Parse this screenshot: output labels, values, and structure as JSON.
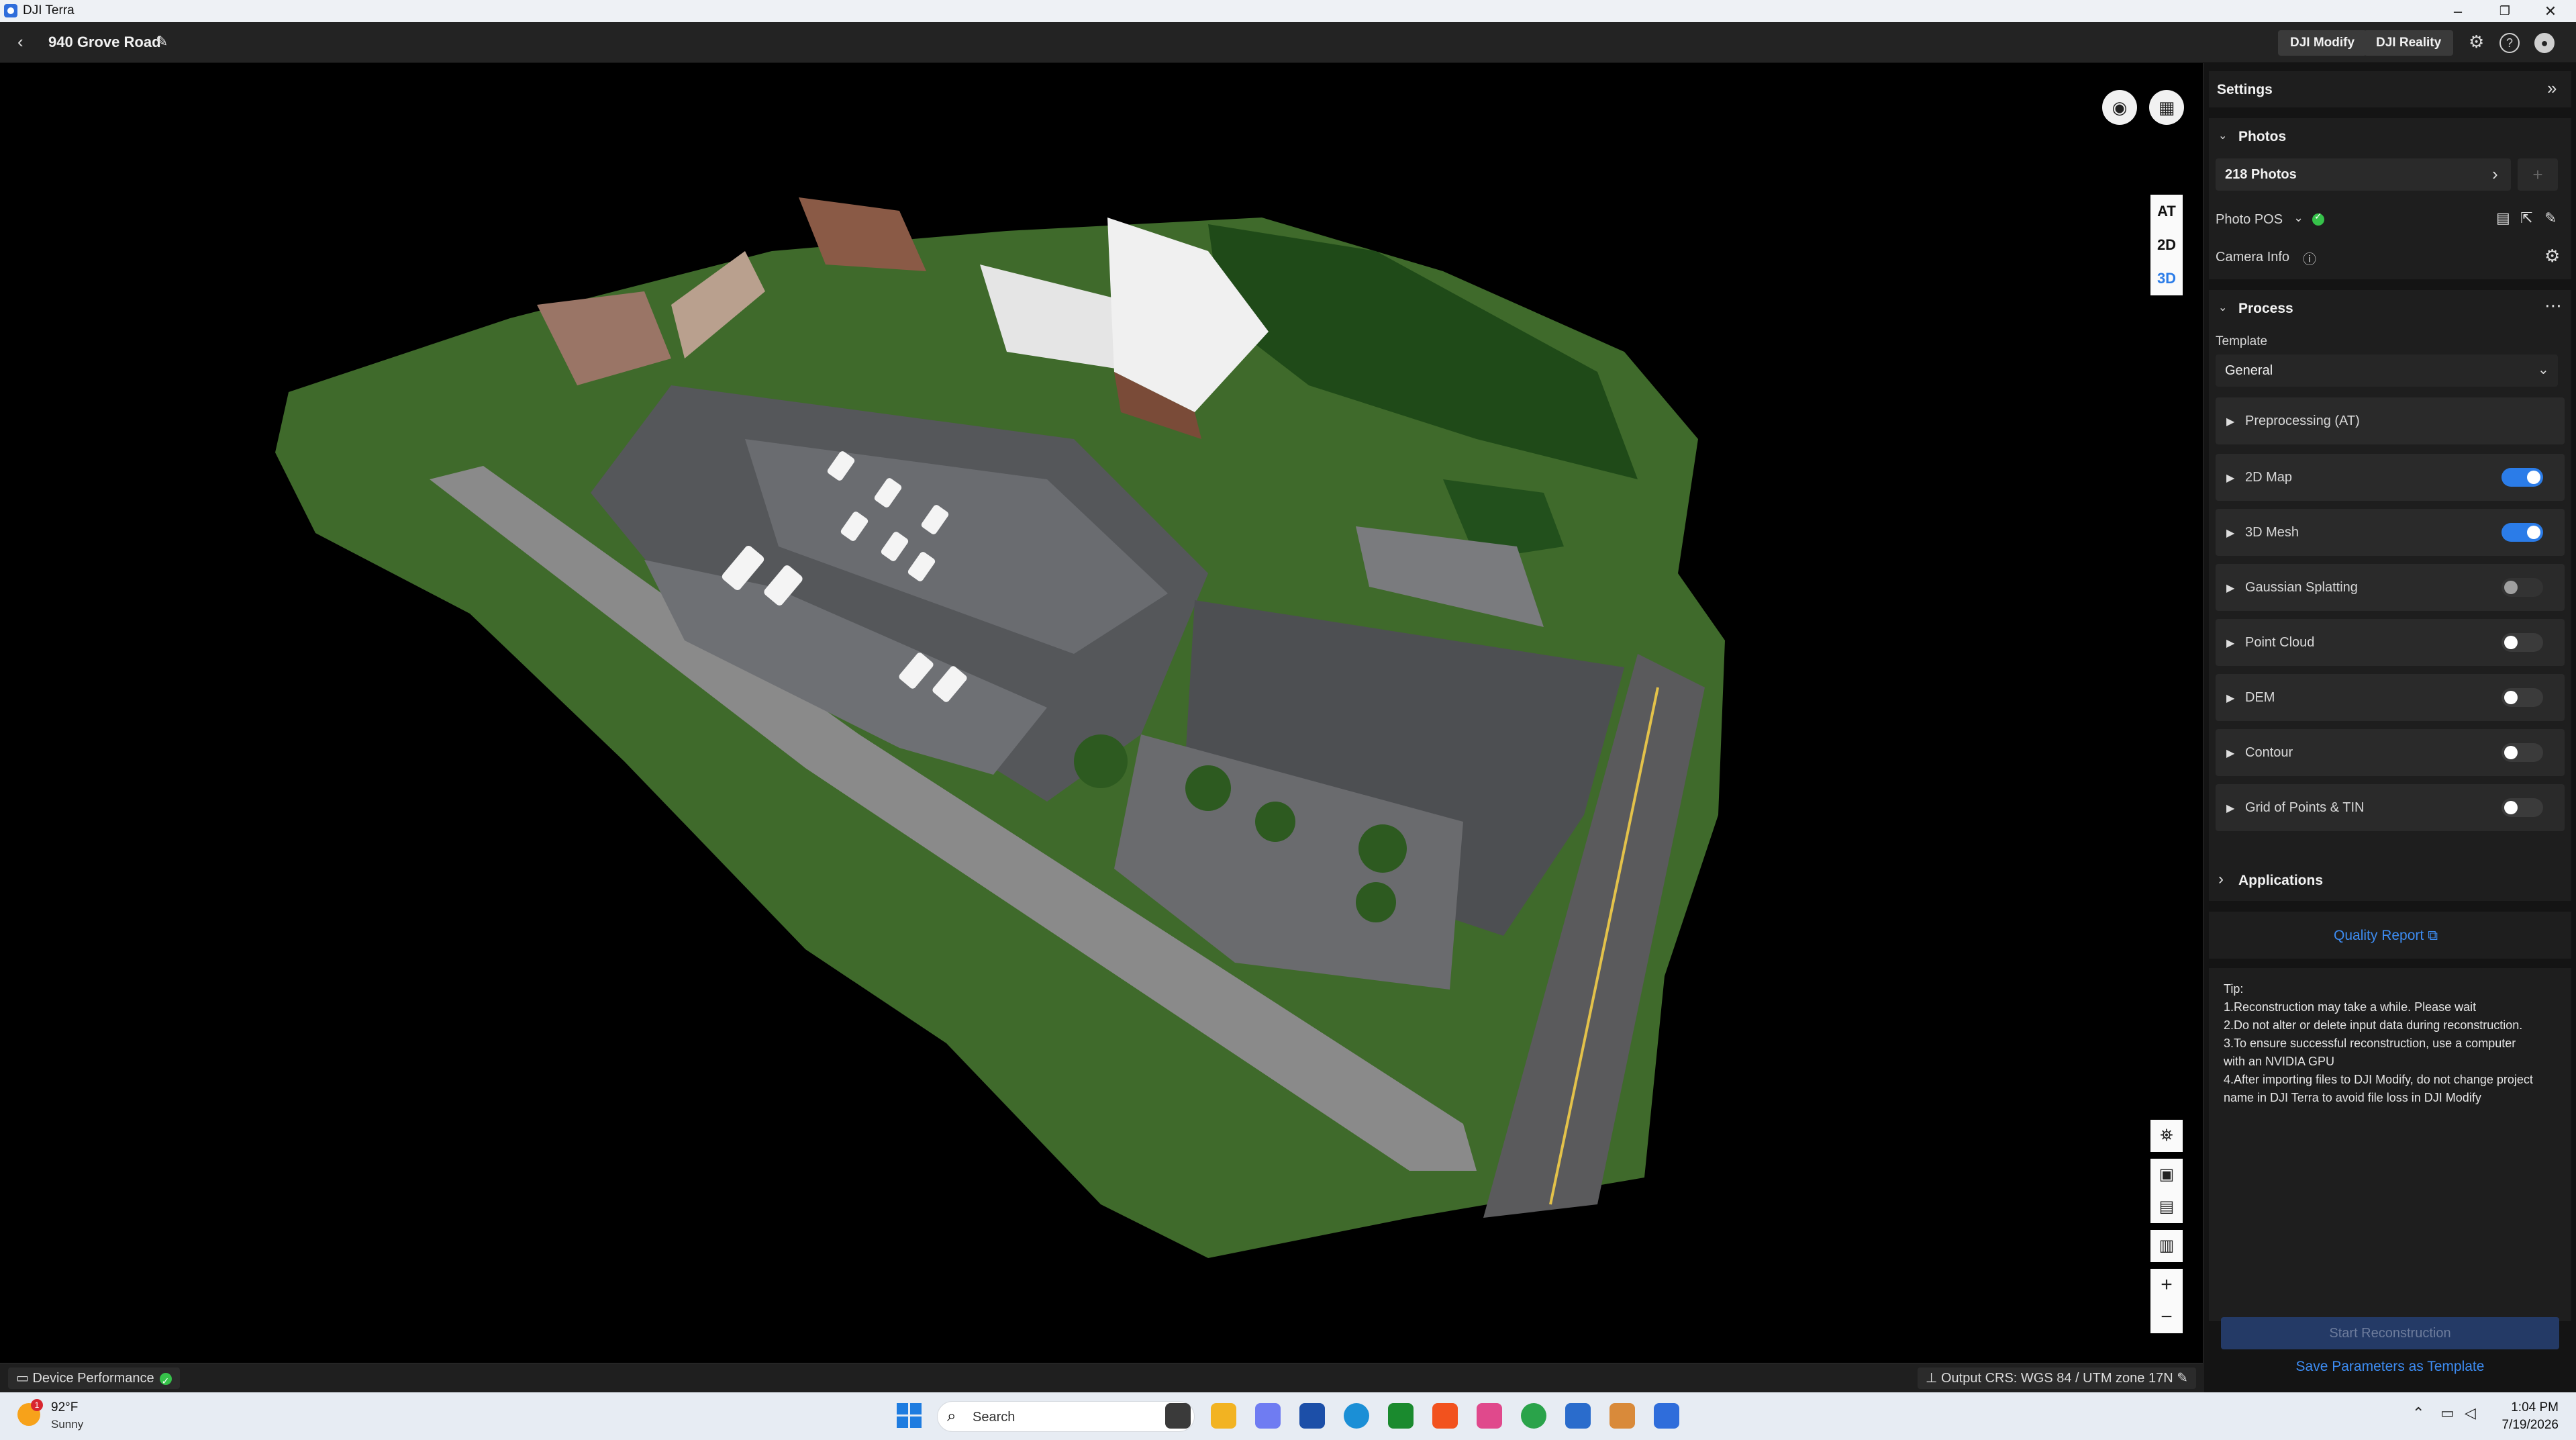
{
  "window": {
    "title": "DJI Terra"
  },
  "header": {
    "project_title": "940 Grove Road",
    "buttons": [
      "DJI Modify",
      "DJI Reality"
    ]
  },
  "viewport": {
    "view_modes": [
      "AT",
      "2D",
      "3D"
    ],
    "active_view_mode": "3D",
    "tools": [
      "camera-icon",
      "map-layers-icon",
      "measure-icon",
      "box-top-icon",
      "box-bottom-icon",
      "building-icon",
      "zoom-in-icon",
      "zoom-out-icon"
    ]
  },
  "status_bar": {
    "device_performance": "Device Performance",
    "output_crs": "Output CRS: WGS 84 / UTM zone 17N"
  },
  "settings": {
    "title": "Settings",
    "photos": {
      "title": "Photos",
      "count_label": "218 Photos",
      "photo_pos_label": "Photo POS",
      "camera_info_label": "Camera Info"
    },
    "process": {
      "title": "Process",
      "template_label": "Template",
      "template_value": "General",
      "items": [
        {
          "label": "Preprocessing (AT)",
          "toggle": null
        },
        {
          "label": "2D Map",
          "toggle": true
        },
        {
          "label": "3D Mesh",
          "toggle": true
        },
        {
          "label": "Gaussian Splatting",
          "toggle": false
        },
        {
          "label": "Point Cloud",
          "toggle": false
        },
        {
          "label": "DEM",
          "toggle": false
        },
        {
          "label": "Contour",
          "toggle": false
        },
        {
          "label": "Grid of Points & TIN",
          "toggle": false
        }
      ]
    },
    "applications_title": "Applications",
    "quality_report": "Quality Report",
    "tip": {
      "title": "Tip:",
      "lines": [
        "1.Reconstruction may take a while. Please wait",
        "2.Do not alter or delete input data during reconstruction.",
        "3.To ensure successful reconstruction, use a computer",
        "with an NVIDIA GPU",
        "4.After importing files to DJI Modify, do not change project",
        "name in DJI Terra to avoid file loss in DJI Modify"
      ]
    },
    "start_button": "Start Reconstruction",
    "save_template": "Save Parameters as Template"
  },
  "taskbar": {
    "weather_badge": "1",
    "weather_temp": "92°F",
    "weather_desc": "Sunny",
    "search_placeholder": "Search",
    "time": "1:04 PM",
    "date": "7/19/2026"
  }
}
